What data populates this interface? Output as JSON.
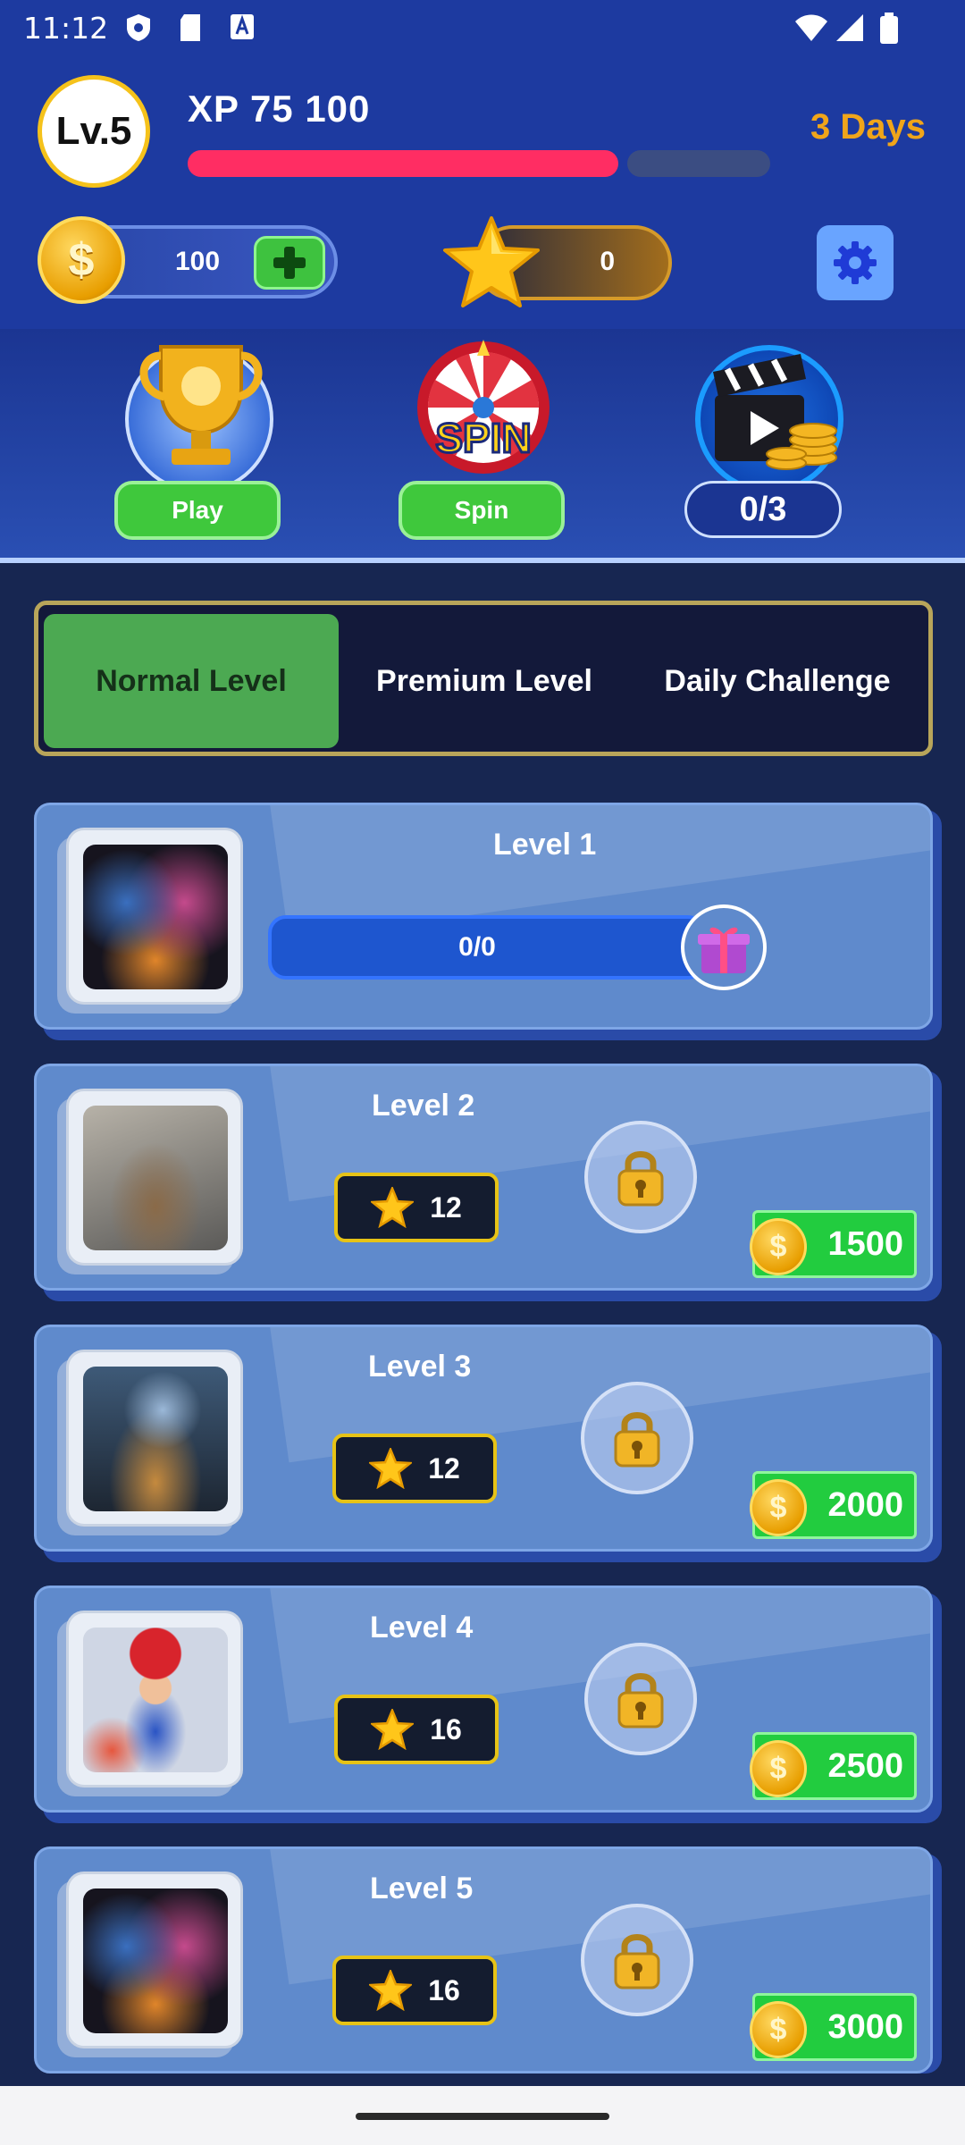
{
  "status_bar": {
    "time": "11:12"
  },
  "header": {
    "level_badge": "Lv.5",
    "xp_label": "XP 75 100",
    "xp_progress": 0.75,
    "days_label": "3 Days"
  },
  "currency": {
    "coins": "100",
    "stars": "0"
  },
  "features": {
    "play_label": "Play",
    "spin_label": "Spin",
    "video_counter": "0/3"
  },
  "tabs": [
    {
      "label": "Normal Level",
      "active": true
    },
    {
      "label": "Premium Level",
      "active": false
    },
    {
      "label": "Daily Challenge",
      "active": false
    }
  ],
  "levels": [
    {
      "title": "Level 1",
      "progress": "0/0",
      "locked": false
    },
    {
      "title": "Level 2",
      "stars": "12",
      "reward": "1500",
      "locked": true
    },
    {
      "title": "Level 3",
      "stars": "12",
      "reward": "2000",
      "locked": true
    },
    {
      "title": "Level 4",
      "stars": "16",
      "reward": "2500",
      "locked": true
    },
    {
      "title": "Level 5",
      "stars": "16",
      "reward": "3000",
      "locked": true
    }
  ],
  "icons": {
    "coin": "dollar-coin-icon",
    "star": "star-icon",
    "settings": "gear-icon",
    "trophy": "trophy-icon",
    "spin": "wheel-icon",
    "video": "clapper-icon",
    "lock": "padlock-icon",
    "gift": "gift-icon"
  },
  "colors": {
    "header_bg": "#1d3aa0",
    "xp_bar": "#ff2d63",
    "days": "#f0a51a",
    "active_tab": "#4ca952",
    "card": "#5f8acc",
    "reward": "#22cc3f"
  }
}
